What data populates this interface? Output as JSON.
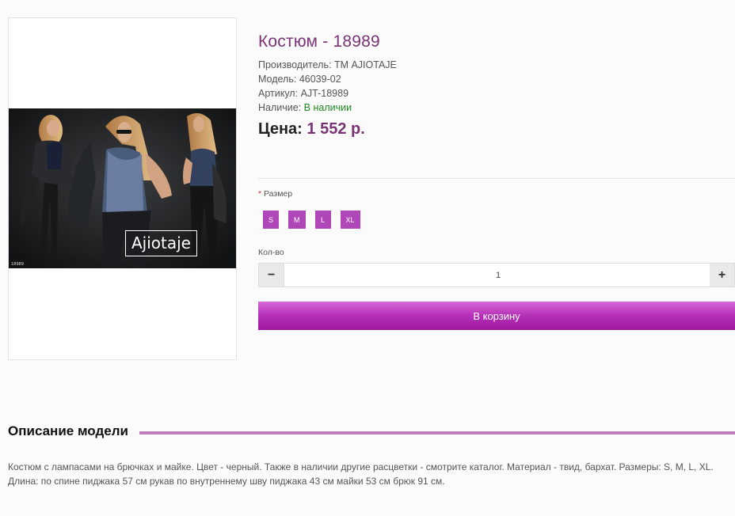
{
  "product": {
    "title": "Костюм - 18989",
    "manufacturer_label": "Производитель:",
    "manufacturer_value": "ТМ AJIOTAJE",
    "model_label": "Модель:",
    "model_value": "46039-02",
    "article_label": "Артикул:",
    "article_value": "AJT-18989",
    "availability_label": "Наличие:",
    "availability_value": "В наличии",
    "price_label": "Цена:",
    "price_value": "1 552 р.",
    "image": {
      "brand_text": "Ajiotaje",
      "number_text": "18989"
    }
  },
  "options": {
    "size_label": "Размер",
    "required_mark": "*",
    "sizes": [
      "S",
      "M",
      "L",
      "XL"
    ],
    "quantity_label": "Кол-во",
    "quantity_value": "1",
    "minus_icon": "−",
    "plus_icon": "+",
    "cart_button": "В корзину"
  },
  "description": {
    "title": "Описание модели",
    "text": "Костюм с лампасами на брючках и майке. Цвет - черный. Также в наличии другие расцветки - смотрите каталог. Материал - твид, бархат. Размеры: S, M, L, XL. Длина: по спине пиджака 57 см рукав по внутреннему шву пиджака 43 см майки 53 см брюк 91 см."
  },
  "colors": {
    "accent": "#7b3376",
    "size_button": "#b047b8",
    "in_stock": "#218a21",
    "cart_button_top": "#d76ad8",
    "cart_button_bottom": "#a0189f"
  }
}
